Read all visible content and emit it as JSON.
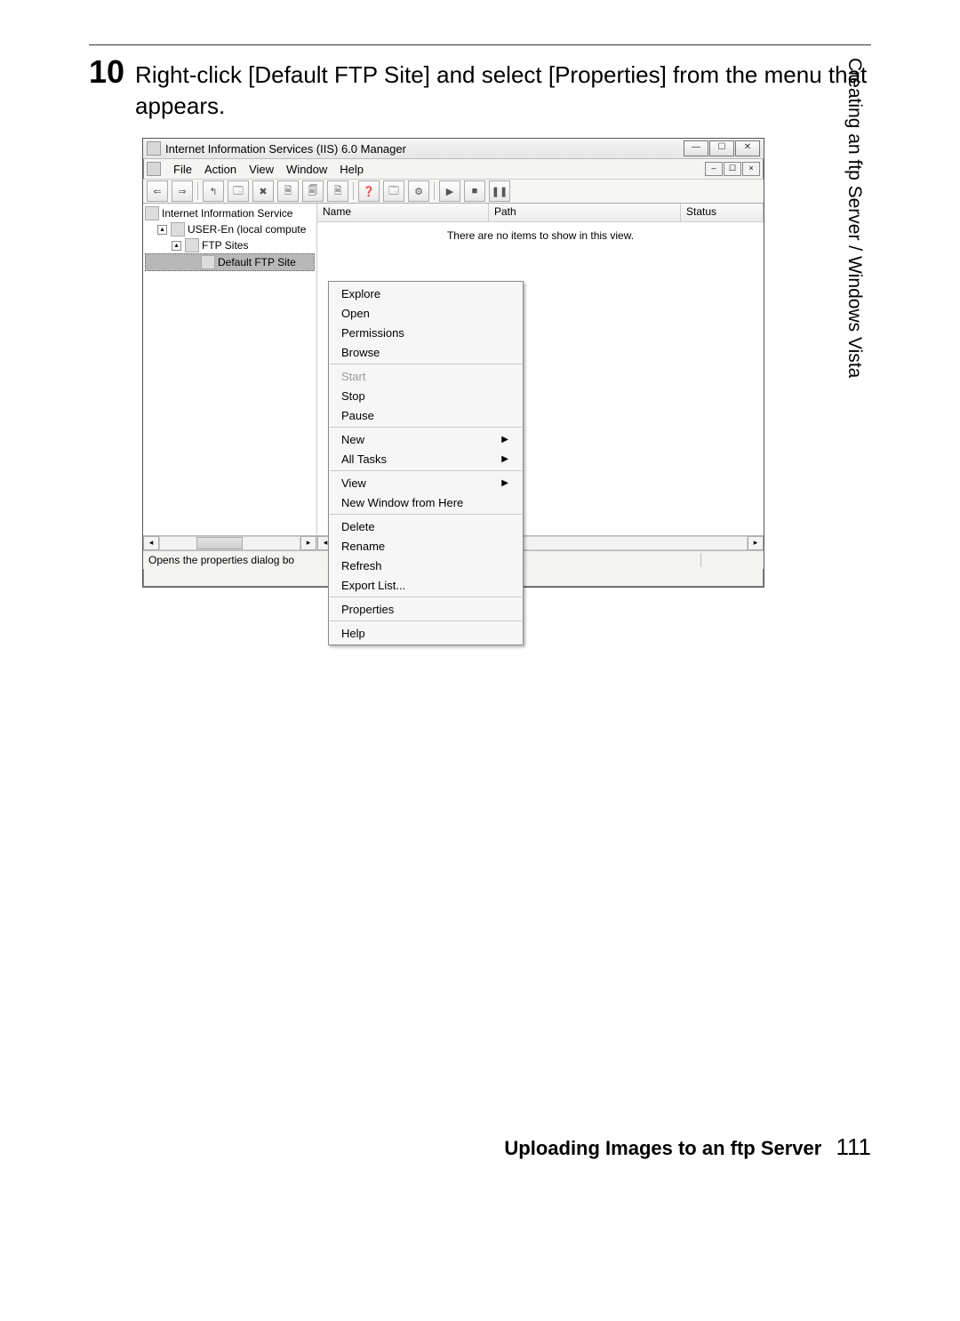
{
  "step": {
    "number": "10",
    "text": "Right-click [Default FTP Site] and select [Properties] from the menu that appears."
  },
  "sidebar_label": "Creating an ftp Server / Windows Vista",
  "footer": {
    "title": "Uploading Images to an ftp Server",
    "page": "111"
  },
  "window": {
    "title": "Internet Information Services (IIS) 6.0 Manager",
    "menus": [
      "File",
      "Action",
      "View",
      "Window",
      "Help"
    ],
    "win_buttons": {
      "min": "—",
      "max": "☐",
      "close": "✕"
    },
    "mdi_buttons": {
      "min": "–",
      "max": "☐",
      "close": "×"
    },
    "toolbar_glyphs": [
      "⇐",
      "⇒",
      "",
      "↰",
      "🗔",
      "✖",
      "🗎",
      "🗐",
      "🗎",
      "",
      "❓",
      "🗔",
      "⚙",
      "",
      "▶",
      "■",
      "❚❚"
    ],
    "tree": [
      {
        "label": "Internet Information Service",
        "indent": 0,
        "icon": true,
        "exp": ""
      },
      {
        "label": "USER-En (local compute",
        "indent": 1,
        "icon": true,
        "exp": "▴"
      },
      {
        "label": "FTP Sites",
        "indent": 2,
        "icon": true,
        "exp": "▴"
      },
      {
        "label": "Default FTP Site",
        "indent": 3,
        "icon": true,
        "sel": true
      }
    ],
    "list_headers": {
      "name": "Name",
      "path": "Path",
      "status": "Status"
    },
    "empty_msg": "There are no items to show in this view.",
    "statusbar": "Opens the properties dialog bo"
  },
  "context_menu": [
    {
      "label": "Explore",
      "type": "item"
    },
    {
      "label": "Open",
      "type": "item"
    },
    {
      "label": "Permissions",
      "type": "item"
    },
    {
      "label": "Browse",
      "type": "item"
    },
    {
      "type": "sep"
    },
    {
      "label": "Start",
      "type": "item",
      "disabled": true
    },
    {
      "label": "Stop",
      "type": "item"
    },
    {
      "label": "Pause",
      "type": "item"
    },
    {
      "type": "sep"
    },
    {
      "label": "New",
      "type": "item",
      "submenu": true
    },
    {
      "label": "All Tasks",
      "type": "item",
      "submenu": true
    },
    {
      "type": "sep"
    },
    {
      "label": "View",
      "type": "item",
      "submenu": true
    },
    {
      "label": "New Window from Here",
      "type": "item"
    },
    {
      "type": "sep"
    },
    {
      "label": "Delete",
      "type": "item"
    },
    {
      "label": "Rename",
      "type": "item"
    },
    {
      "label": "Refresh",
      "type": "item"
    },
    {
      "label": "Export List...",
      "type": "item"
    },
    {
      "type": "sep"
    },
    {
      "label": "Properties",
      "type": "item"
    },
    {
      "type": "sep"
    },
    {
      "label": "Help",
      "type": "item"
    }
  ]
}
